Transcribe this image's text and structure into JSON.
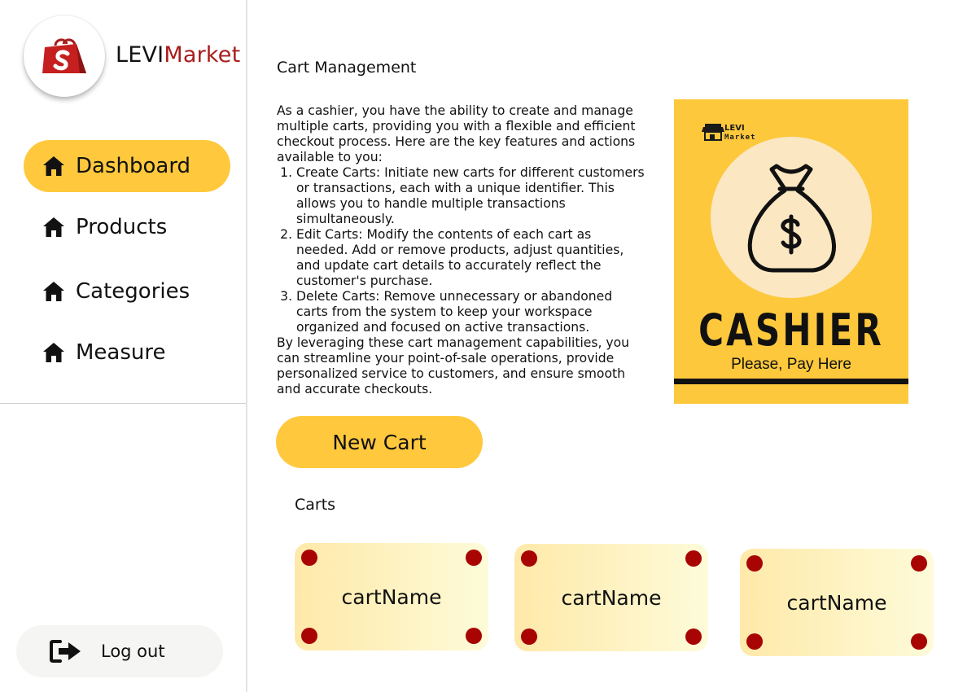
{
  "brand": {
    "part1": "LEVI",
    "part2": "Market",
    "accent_color": "#a81c1c"
  },
  "sidebar": {
    "items": [
      {
        "label": "Dashboard",
        "icon": "home-icon",
        "active": true
      },
      {
        "label": "Products",
        "icon": "home-icon",
        "active": false
      },
      {
        "label": "Categories",
        "icon": "home-icon",
        "active": false
      },
      {
        "label": "Measure",
        "icon": "home-icon",
        "active": false
      }
    ],
    "logout": {
      "label": "Log out",
      "icon": "logout-icon"
    }
  },
  "main": {
    "title": "Cart Management",
    "intro": "As a cashier, you have the ability to create and manage multiple carts, providing you with a flexible and efficient checkout process. Here are the key features and actions available to you:",
    "features": [
      "Create Carts: Initiate new carts for different customers or transactions, each with a unique identifier. This allows you to handle multiple transactions simultaneously.",
      "Edit Carts: Modify the contents of each cart as needed. Add or remove products, adjust quantities, and update cart details to accurately reflect the customer's purchase.",
      "Delete Carts: Remove unnecessary or abandoned carts from the system to keep your workspace organized and focused on active transactions."
    ],
    "outro": "By leveraging these cart management capabilities, you can streamline your point-of-sale operations, provide personalized service to customers, and ensure smooth and accurate checkouts.",
    "new_cart_label": "New Cart",
    "carts_label": "Carts"
  },
  "poster": {
    "logo_line1": "LEVI",
    "logo_line2": "Market",
    "heading": "CASHIER",
    "subheading": "Please, Pay Here",
    "bg_color": "#fdc83c"
  },
  "carts": [
    {
      "name": "cartName"
    },
    {
      "name": "cartName"
    },
    {
      "name": "cartName"
    }
  ],
  "colors": {
    "accent": "#ffc83d",
    "cart_dot": "#a80404"
  }
}
